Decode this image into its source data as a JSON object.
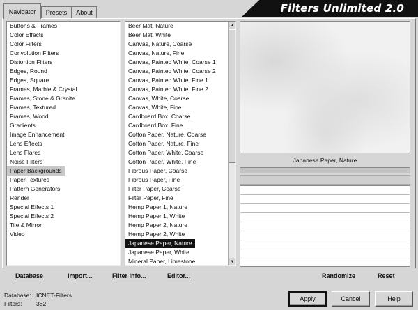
{
  "window_title": "Filters Unlimited 2.0",
  "tabs": [
    {
      "label": "Navigator",
      "active": true
    },
    {
      "label": "Presets",
      "active": false
    },
    {
      "label": "About",
      "active": false
    }
  ],
  "categories": [
    "Buttons & Frames",
    "Color Effects",
    "Color Filters",
    "Convolution Filters",
    "Distortion Filters",
    "Edges, Round",
    "Edges, Square",
    "Frames, Marble & Crystal",
    "Frames, Stone & Granite",
    "Frames, Textured",
    "Frames, Wood",
    "Gradients",
    "Image Enhancement",
    "Lens Effects",
    "Lens Flares",
    "Noise Filters",
    "Paper Backgrounds",
    "Paper Textures",
    "Pattern Generators",
    "Render",
    "Special Effects 1",
    "Special Effects 2",
    "Tile & Mirror",
    "Video"
  ],
  "selected_category": "Paper Backgrounds",
  "filters": [
    "Beer Mat, Nature",
    "Beer Mat, White",
    "Canvas, Nature, Coarse",
    "Canvas, Nature, Fine",
    "Canvas, Painted White, Coarse 1",
    "Canvas, Painted White, Coarse 2",
    "Canvas, Painted White, Fine 1",
    "Canvas, Painted White, Fine 2",
    "Canvas, White, Coarse",
    "Canvas, White, Fine",
    "Cardboard Box, Coarse",
    "Cardboard Box, Fine",
    "Cotton Paper, Nature, Coarse",
    "Cotton Paper, Nature, Fine",
    "Cotton Paper, White, Coarse",
    "Cotton Paper, White, Fine",
    "Fibrous Paper, Coarse",
    "Fibrous Paper, Fine",
    "Filter Paper, Coarse",
    "Filter Paper, Fine",
    "Hemp Paper 1, Nature",
    "Hemp Paper 1, White",
    "Hemp Paper 2, Nature",
    "Hemp Paper 2, White",
    "Japanese Paper, Nature",
    "Japanese Paper, White",
    "Mineral Paper, Limestone"
  ],
  "selected_filter": "Japanese Paper, Nature",
  "preview_label": "Japanese Paper, Nature",
  "toolbar": {
    "database": "Database",
    "import": "Import...",
    "filter_info": "Filter Info...",
    "editor": "Editor...",
    "randomize": "Randomize",
    "reset": "Reset"
  },
  "info": {
    "database_label": "Database:",
    "database_value": "ICNET-Filters",
    "filters_label": "Filters:",
    "filters_value": "382"
  },
  "buttons": {
    "apply": "Apply",
    "cancel": "Cancel",
    "help": "Help"
  },
  "scroll_arrows": {
    "up": "▲",
    "down": "▼"
  }
}
